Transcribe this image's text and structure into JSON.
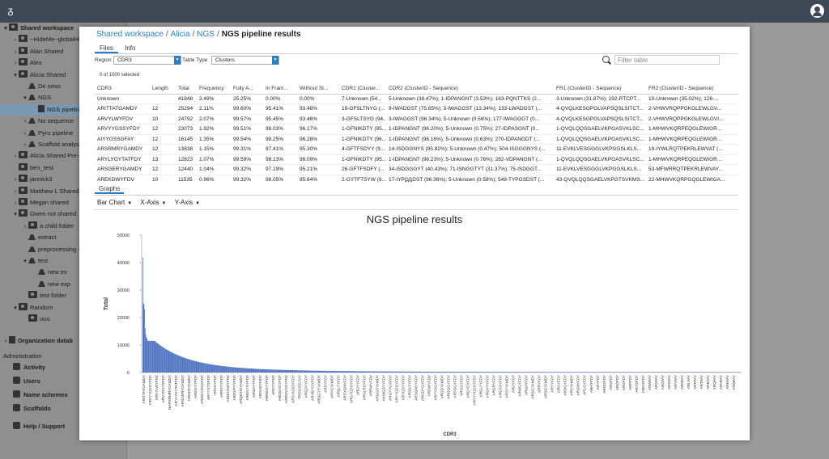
{
  "sidebar": {
    "tree": [
      {
        "label": "Shared workspace",
        "depth": 0,
        "caret": "▾",
        "icon": "folder-icon",
        "bold": true
      },
      {
        "label": "~HideMe~globalHi",
        "depth": 1,
        "caret": "›",
        "icon": "folder-icon"
      },
      {
        "label": "Alan Shared",
        "depth": 1,
        "caret": "›",
        "icon": "folder-icon"
      },
      {
        "label": "Alex",
        "depth": 1,
        "caret": "›",
        "icon": "folder-icon"
      },
      {
        "label": "Alicia Shared",
        "depth": 1,
        "caret": "▾",
        "icon": "folder-icon"
      },
      {
        "label": "De novo",
        "depth": 2,
        "caret": "",
        "icon": "flask-icon"
      },
      {
        "label": "NGS",
        "depth": 2,
        "caret": "▾",
        "icon": "flask-icon"
      },
      {
        "label": "NGS pipeline re",
        "depth": 3,
        "caret": "",
        "icon": "doc-icon",
        "selected": true
      },
      {
        "label": "No sequence",
        "depth": 2,
        "caret": "›",
        "icon": "flask-icon"
      },
      {
        "label": "Pyro pipeline",
        "depth": 2,
        "caret": "›",
        "icon": "flask-icon"
      },
      {
        "label": "Scaffold analysis",
        "depth": 2,
        "caret": "›",
        "icon": "flask-icon"
      },
      {
        "label": "Alicia Shared Pre-",
        "depth": 1,
        "caret": "›",
        "icon": "folder-icon"
      },
      {
        "label": "ben_test",
        "depth": 1,
        "caret": "",
        "icon": "folder-icon"
      },
      {
        "label": "jannick3",
        "depth": 1,
        "caret": "›",
        "icon": "folder-icon"
      },
      {
        "label": "Matthew L Shared",
        "depth": 1,
        "caret": "›",
        "icon": "folder-icon"
      },
      {
        "label": "Megan shared",
        "depth": 1,
        "caret": "›",
        "icon": "folder-icon"
      },
      {
        "label": "Owen not shared",
        "depth": 1,
        "caret": "▾",
        "icon": "folder-icon"
      },
      {
        "label": "a child folder",
        "depth": 2,
        "caret": "›",
        "icon": "folder-icon"
      },
      {
        "label": "extract",
        "depth": 2,
        "caret": "",
        "icon": "flask-icon"
      },
      {
        "label": "preprocessing -",
        "depth": 2,
        "caret": "",
        "icon": "flask-icon"
      },
      {
        "label": "test",
        "depth": 2,
        "caret": "▾",
        "icon": "flask-icon"
      },
      {
        "label": "new ex",
        "depth": 3,
        "caret": "",
        "icon": "flask-icon"
      },
      {
        "label": "new exp",
        "depth": 3,
        "caret": "",
        "icon": "flask-icon"
      },
      {
        "label": "test folder",
        "depth": 2,
        "caret": "",
        "icon": "folder-icon"
      },
      {
        "label": "Random",
        "depth": 1,
        "caret": "▾",
        "icon": "folder-icon"
      },
      {
        "label": "uuu",
        "depth": 2,
        "caret": "",
        "icon": "folder-icon"
      }
    ],
    "org_label": "Organization datab",
    "admin_label": "Administration",
    "admin_items": [
      {
        "label": "Activity",
        "icon": "activity-icon"
      },
      {
        "label": "Users",
        "icon": "users-icon"
      },
      {
        "label": "Name schemes",
        "icon": "list-icon"
      },
      {
        "label": "Scaffolds",
        "icon": "list-icon"
      }
    ],
    "help_label": "Help / Support"
  },
  "modal": {
    "breadcrumb": [
      "Shared workspace",
      "Alicia",
      "NGS"
    ],
    "current": "NGS pipeline results",
    "tabs": [
      "Files",
      "Info"
    ],
    "region_label": "Region",
    "region_value": "CDR3",
    "table_type_label": "Table Type",
    "table_type_value": "Clusters",
    "filter_placeholder": "Filter table",
    "selected_count": "0 of 1000 selected",
    "columns": [
      "CDR3",
      "Length",
      "Total",
      "Frequency",
      "Fully A...",
      "In Fram...",
      "Without St...",
      "CDR1 (Cluster...",
      "CDR2 (ClusterID - Sequence)",
      "FR1 (ClusterID - Sequence)",
      "FR2 (ClusterID - Sequence)"
    ],
    "rows": [
      [
        "Unknown",
        "",
        "41848",
        "3.49%",
        "25.25%",
        "0.00%",
        "0.00%",
        "7-Unknown (54...",
        "5-Unknown (38.47%); 1-IDPANGNT (3.53%); 163-PQNTTKS (2...",
        "3-Unknown (31.87%); 192-RTCPT...",
        "10-Unknown (35.02%); 126-..."
      ],
      [
        "ARITTATGAMDY",
        "12",
        "25294",
        "2.11%",
        "99.60%",
        "95.41%",
        "93.48%",
        "19-GFSLTNYG (...",
        "9-IWADGST (75.65%); 3-IWAGGST (13.34%); 133-LWADGST (...",
        "4-QVQLKESGPGLVAPSQSLSITCT...",
        "2-VHWVRQPPGKGLEWLGV..."
      ],
      [
        "ARVYLWYFDV",
        "10",
        "24792",
        "2.07%",
        "99.57%",
        "95.45%",
        "93.46%",
        "3-GFSLTSYG (94...",
        "3-IWAGGST (96.34%); 5-Unknown (0.56%); 177-IWAGGGT (0...",
        "4-QVQLKESGPGLVAPSQSLSITCT...",
        "2-VHWVRQPPGKGLEWLGVI..."
      ],
      [
        "ARVYYGSSYFDY",
        "12",
        "23073",
        "1.92%",
        "99.51%",
        "98.03%",
        "96.17%",
        "1-GFNIKDTY (95...",
        "1-IDPANGNT (96.20%); 5-Unknown (0.75%); 27-IDPASGNT (0...",
        "1-QVQLQQSGAELVKPGASVKLSC...",
        "1-MHWVKQRPEQGLEWIGR..."
      ],
      [
        "AIYYGSSGFAY",
        "12",
        "16145",
        "1.35%",
        "99.54%",
        "98.25%",
        "96.28%",
        "1-GFNIKDTY (96...",
        "1-IDPANGNT (96.16%); 5-Unknown (0.63%); 270-IDPANGDT (...",
        "1-QVQLQQSGAELVKPGASVKLSC...",
        "1-MHWVKQRPEQGLEWIGR..."
      ],
      [
        "ARSRMRYGAMDY",
        "12",
        "13838",
        "1.15%",
        "99.31%",
        "97.41%",
        "95.30%",
        "4-GFTFSDYY (9...",
        "14-ISDGGNYS (95.82%); 5-Unknown (0.47%); 504-ISGGGNYS (...",
        "11-EVKLVESGGGLVKPGGSLKLS...",
        "19-IYWLRQTPEKRLEWVAT (..."
      ],
      [
        "ARYLYGYTATFDY",
        "13",
        "12823",
        "1.07%",
        "99.59%",
        "98.13%",
        "96.09%",
        "1-GFNIKDTY (95...",
        "1-IDPANGNT (96.23%); 5-Unknown (0.76%); 282-VDPANGNT (...",
        "1-QVQLQQSGAELVKPGASVKLSC...",
        "1-MHWVKQRPEQGLEWIGR..."
      ],
      [
        "ARSGERYGAMDY",
        "12",
        "12440",
        "1.04%",
        "99.32%",
        "97.19%",
        "95.21%",
        "26-GFTFSDFY (...",
        "34-ISDGGGYT (40.43%); 71-ISNGGTYT (31.37%); 75-ISDGGT...",
        "11-EVKLVESGGGLVKPGGSLKLS...",
        "53-MFWRRQTPEKRLEWVAY..."
      ],
      [
        "AREKDWYFDV",
        "10",
        "11535",
        "0.96%",
        "99.32%",
        "98.05%",
        "95.64%",
        "2-GYTFTSYW (9...",
        "17-IYPGSDST (96.36%); 5-Unknown (0.58%); 549-TYPGSDST (...",
        "43-QVQLQQSGAELVKPGTSVKMS...",
        "22-MHWVKQRPGQGLEWIGA..."
      ]
    ],
    "graphs_tab": "Graphs",
    "graph_controls": [
      "Bar Chart",
      "X-Axis",
      "Y-Axis"
    ]
  },
  "chart_data": {
    "type": "bar",
    "title": "NGS pipeline results",
    "xlabel": "CDR3",
    "ylabel": "Total",
    "ylim": [
      0,
      50000
    ],
    "yticks": [
      0,
      10000,
      20000,
      30000,
      40000,
      50000
    ],
    "bar_color": "#4a6fbf",
    "n_bars": 1000,
    "values_first": [
      41848,
      25294,
      24792,
      23073,
      16145,
      13838,
      12823,
      12440,
      11535
    ],
    "categories_visible": [
      "ARITTATGAMDY",
      "ARVYYGSSYFDY",
      "ARVYLWYFDV",
      "ARVYRSYSFDY",
      "NARSRMRYGAMDY",
      "ARYLYGYTATFDY",
      "ARSGERYGAMDY",
      "ARGDSYAMDY",
      "ARGGYYFDY",
      "ARDGYGVGFDY",
      "ARYYSYSFDY",
      "ARSSYFDY",
      "ARRSYYFDY",
      "ARDGGWYFDV",
      "ARGVPYYFDY",
      "ARQGHSYAMDY",
      "AREGYSYFDY",
      "ARSDYYFDY",
      "ARGVDYHDY",
      "ARRGGYYFDY",
      "ARSYYFDY",
      "ARDGYGYFDY",
      "ARRGVSSYFDV",
      "ARSYGSDYFDY",
      "TRSGSSLFAY",
      "ARGDYYFDY",
      "ARHGYDYFDY",
      "ARGGYYYAMDY",
      "ARSYFDY",
      "ARYGYAMDY",
      "ARQLYYFDY",
      "ARSYGNYFDY",
      "ARGYGSSYFDY",
      "ARDYYFDY",
      "ARGLRSYFDY",
      "ARRWYFDV",
      "ARGGSYAMDY",
      "AKWGSYYFDY",
      "ARGYYGSFDY",
      "ARYYGSSYFDY",
      "ARYGSYYFDY",
      "ARSGYYFDY",
      "ARSGNYYFDY",
      "ARGDYGYFDY",
      "ARDWYFDV",
      "ARYYSGYFDY",
      "ARGDYAMDY",
      "ARGGGYFDY",
      "ARSSGYFDY",
      "VRGGYFDY",
      "ARGYDYFDY",
      "ARYYYGSSYFDY",
      "ARGLYYFDY",
      "ARGVYYFDY",
      "ARGRYFDY",
      "ARGSSYFDY",
      "ARSYYAMDY",
      "ARDYFDY",
      "ARWGYFDY",
      "ARGAYFDY",
      "ARGGYAMDY",
      "ARRYFDY",
      "ARSGYAMDY",
      "ARYYFDY",
      "ARGYFDY",
      "ARDGYFDY",
      "ARSYAMDY",
      "ARGNYFDY",
      "ARLGYFDY",
      "ARHYFDY",
      "ARYFDY",
      "ARGGFDY",
      "ARSFDY",
      "ARDFDY",
      "ARGFDY",
      "ARPFDY",
      "ARYSFDY",
      "ARGSFDY",
      "ARWFAY",
      "ARDFAY",
      "ARGFAY",
      "ARSFAY",
      "ARYFAY",
      "ARNFAY",
      "ARLFAY",
      "ARPFAY",
      "ARTFAY",
      "AREFAY",
      "ARQFAY",
      "ARHFAY",
      "ARKFAY",
      "ARMFAY"
    ]
  }
}
